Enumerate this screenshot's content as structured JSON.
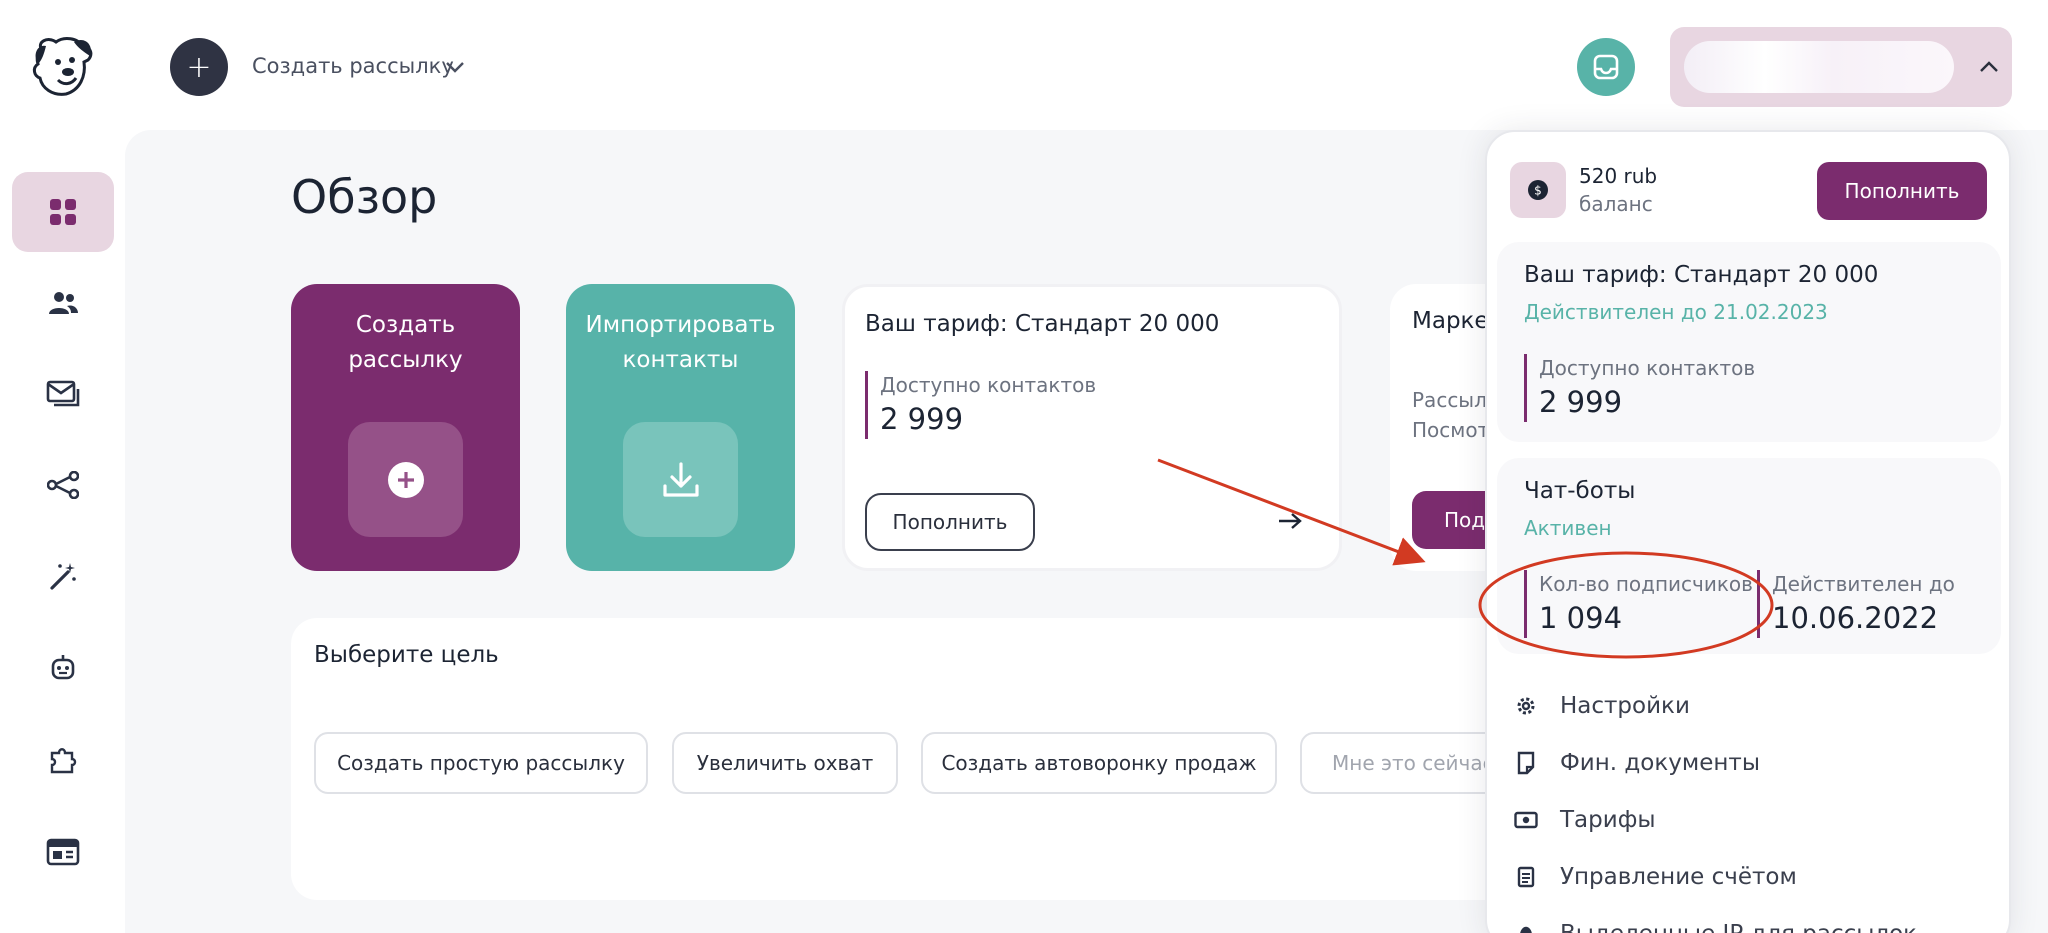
{
  "header": {
    "create_label": "Создать рассылку"
  },
  "page": {
    "title": "Обзор"
  },
  "tiles": {
    "create_title": "Создать рассылку",
    "import_title": "Импортировать контакты"
  },
  "tariff_card": {
    "title": "Ваш тариф: Стандарт 20 000",
    "contacts_label": "Доступно контактов",
    "contacts_value": "2 999",
    "topup_label": "Пополнить"
  },
  "market_card": {
    "title": "Марке",
    "line1": "Рассыл",
    "line2": "Посмот",
    "button_label": "Под"
  },
  "goals": {
    "title": "Выберите цель",
    "chips": [
      "Создать простую рассылку",
      "Увеличить охват",
      "Создать автоворонку продаж",
      "Мне это сейчас"
    ]
  },
  "dropdown": {
    "balance_amount": "520 rub",
    "balance_label": "баланс",
    "topup_label": "Пополнить",
    "tariff_title": "Ваш тариф: Стандарт 20 000",
    "tariff_valid": "Действителен до 21.02.2023",
    "contacts_label": "Доступно контактов",
    "contacts_value": "2 999",
    "bots_title": "Чат-боты",
    "bots_status": "Активен",
    "subscribers_label": "Кол-во подписчиков",
    "subscribers_value": "1 094",
    "bots_valid_label": "Действителен до",
    "bots_valid_value": "10.06.2022",
    "menu": [
      "Настройки",
      "Фин. документы",
      "Тарифы",
      "Управление счётом",
      "Выделенные IP для рассылок"
    ]
  },
  "icons": {
    "sidebar": [
      "dashboard-icon",
      "contacts-icon",
      "mailings-icon",
      "automation-icon",
      "magic-wand-icon",
      "chatbot-icon",
      "integrations-icon",
      "landing-icon"
    ]
  },
  "colors": {
    "brand_purple": "#7b2c6e",
    "brand_teal": "#57b3a9",
    "annotation_red": "#d23a22"
  }
}
